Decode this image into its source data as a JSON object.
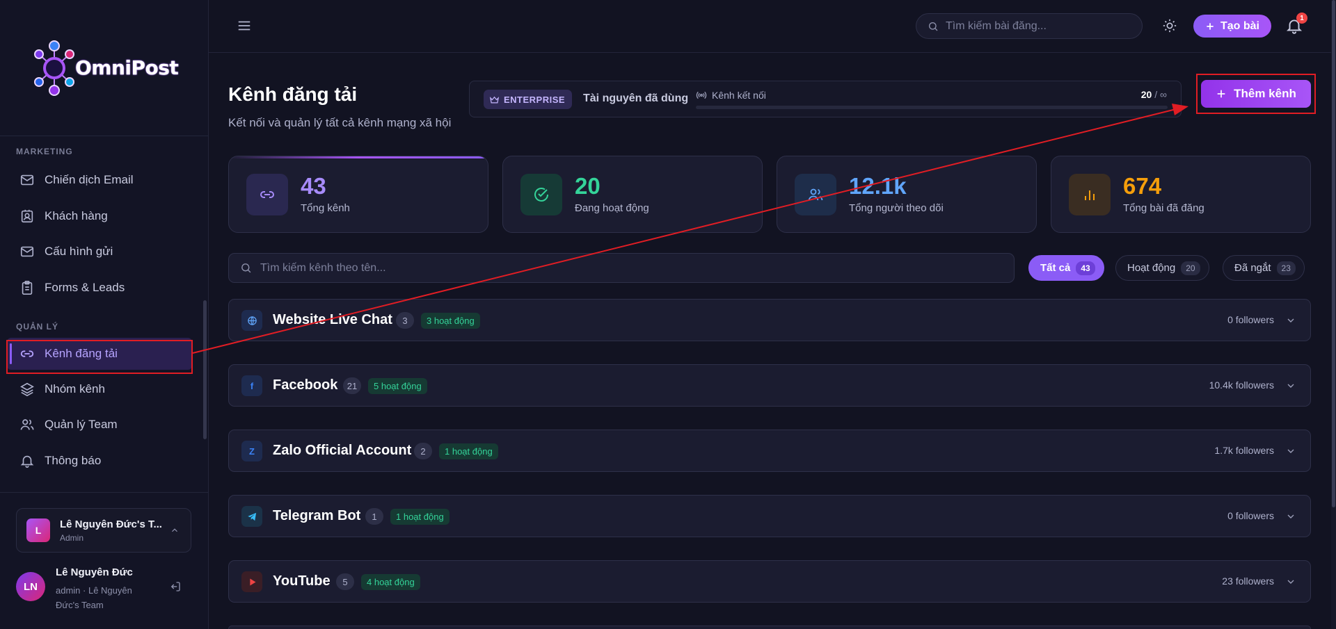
{
  "app": {
    "name": "OmniPost"
  },
  "colors": {
    "accent": "#8b5cf6",
    "annotation": "#e11d24",
    "success": "#34d399"
  },
  "sidebar": {
    "sections": [
      {
        "title": "MARKETING",
        "items": [
          {
            "label": "Chiến dịch Email",
            "icon": "mail-icon"
          },
          {
            "label": "Khách hàng",
            "icon": "contact-icon"
          },
          {
            "label": "Cấu hình gửi",
            "icon": "mail-settings-icon"
          },
          {
            "label": "Forms & Leads",
            "icon": "clipboard-icon"
          }
        ]
      },
      {
        "title": "QUẢN LÝ",
        "items": [
          {
            "label": "Kênh đăng tải",
            "icon": "link-icon",
            "active": true
          },
          {
            "label": "Nhóm kênh",
            "icon": "layers-icon"
          },
          {
            "label": "Quản lý Team",
            "icon": "users-icon"
          },
          {
            "label": "Thông báo",
            "icon": "bell-icon"
          }
        ]
      }
    ],
    "team": {
      "initial": "L",
      "name": "Lê Nguyên Đức's T...",
      "role": "Admin"
    },
    "user": {
      "initials": "LN",
      "name": "Lê Nguyên Đức",
      "sub": "admin · Lê Nguyên Đức's Team"
    }
  },
  "topbar": {
    "search_placeholder": "Tìm kiếm bài đăng...",
    "create_label": "Tạo bài",
    "notification_count": "1"
  },
  "header": {
    "title": "Kênh đăng tải",
    "subtitle": "Kết nối và quản lý tất cả kênh mạng xã hội",
    "plan_badge": "ENTERPRISE",
    "plan_label": "Tài nguyên đã dùng",
    "resource_label": "Kênh kết nối",
    "resource_used": "20",
    "resource_limit": "∞",
    "resource_fraction": 0,
    "add_channel_label": "Thêm kênh"
  },
  "stats": [
    {
      "value": "43",
      "label": "Tổng kênh",
      "icon": "link-icon",
      "color": "#a78bfa"
    },
    {
      "value": "20",
      "label": "Đang hoạt động",
      "icon": "check-circle-icon",
      "color": "#34d399"
    },
    {
      "value": "12.1k",
      "label": "Tổng người theo dõi",
      "icon": "users-icon",
      "color": "#60a5fa"
    },
    {
      "value": "674",
      "label": "Tổng bài đã đăng",
      "icon": "bar-chart-icon",
      "color": "#f59e0b"
    }
  ],
  "filters": {
    "search_placeholder": "Tìm kiếm kênh theo tên...",
    "chips": [
      {
        "label": "Tất cả",
        "count": "43",
        "active": true
      },
      {
        "label": "Hoạt động",
        "count": "20"
      },
      {
        "label": "Đã ngắt",
        "count": "23"
      }
    ]
  },
  "channel_groups": [
    {
      "name": "Website Live Chat",
      "count": "3",
      "active": "3 hoạt động",
      "followers": "0 followers",
      "icon": "globe-icon"
    },
    {
      "name": "Facebook",
      "count": "21",
      "active": "5 hoạt động",
      "followers": "10.4k followers",
      "icon": "facebook-icon",
      "glyph": "f"
    },
    {
      "name": "Zalo Official Account",
      "count": "2",
      "active": "1 hoạt động",
      "followers": "1.7k followers",
      "icon": "zalo-icon",
      "glyph": "Z"
    },
    {
      "name": "Telegram Bot",
      "count": "1",
      "active": "1 hoạt động",
      "followers": "0 followers",
      "icon": "telegram-icon"
    },
    {
      "name": "YouTube",
      "count": "5",
      "active": "4 hoạt động",
      "followers": "23 followers",
      "icon": "youtube-icon"
    }
  ]
}
